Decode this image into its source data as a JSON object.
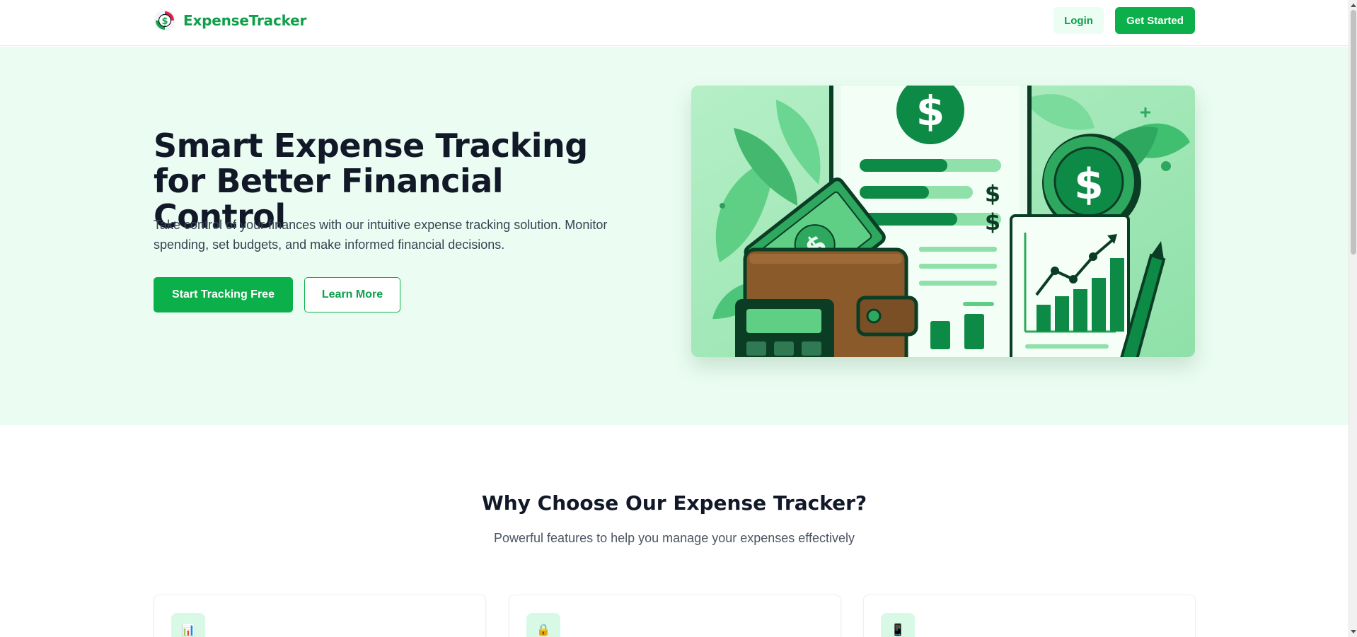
{
  "header": {
    "brand_name": "ExpenseTracker",
    "logo_icon": "dollar-coin-logo-icon",
    "login_label": "Login",
    "get_started_label": "Get Started"
  },
  "hero": {
    "title": "Smart Expense Tracking for Better Financial Control",
    "description": "Take control of your finances with our intuitive expense tracking solution. Monitor spending, set budgets, and make informed financial decisions.",
    "primary_cta": "Start Tracking Free",
    "secondary_cta": "Learn More",
    "illustration": "wallet-money-chart-illustration"
  },
  "features": {
    "title": "Why Choose Our Expense Tracker?",
    "subtitle": "Powerful features to help you manage your expenses effectively",
    "cards": [
      {
        "icon": "bar-chart-icon",
        "glyph": "📊"
      },
      {
        "icon": "lock-icon",
        "glyph": "🔒"
      },
      {
        "icon": "mobile-phone-icon",
        "glyph": "📱"
      }
    ]
  },
  "colors": {
    "brand": "#0cb04a",
    "brand_dark": "#0d9f4b",
    "hero_bg": "#ebfdf2",
    "heading": "#111827",
    "body_text": "#374151"
  }
}
